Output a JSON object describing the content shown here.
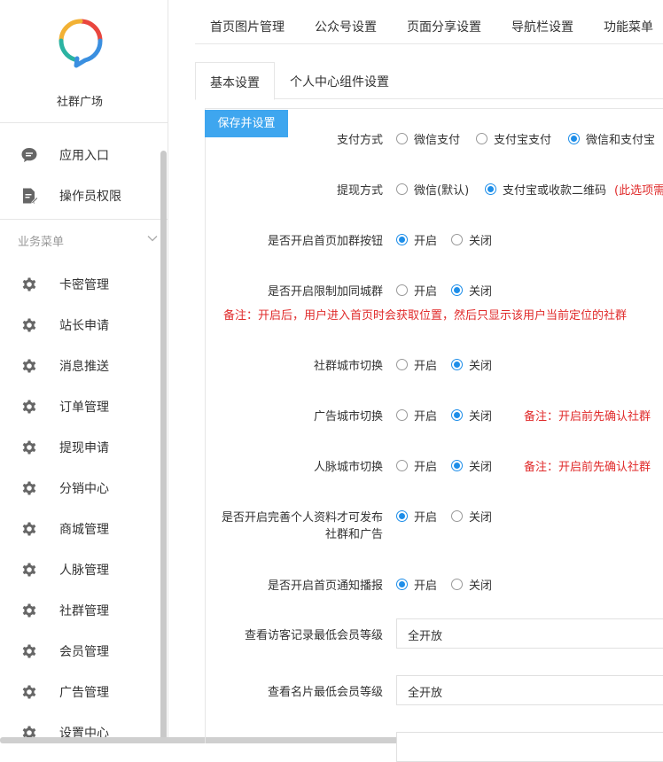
{
  "sidebar": {
    "brand": "社群广场",
    "items_top": [
      {
        "label": "应用入口",
        "icon": "chat-bubble-icon"
      },
      {
        "label": "操作员权限",
        "icon": "document-edit-icon"
      }
    ],
    "group_title": "业务菜单",
    "items": [
      {
        "label": "卡密管理",
        "icon": "gear-icon"
      },
      {
        "label": "站长申请",
        "icon": "gear-icon"
      },
      {
        "label": "消息推送",
        "icon": "gear-icon"
      },
      {
        "label": "订单管理",
        "icon": "gear-icon"
      },
      {
        "label": "提现申请",
        "icon": "gear-icon"
      },
      {
        "label": "分销中心",
        "icon": "gear-icon"
      },
      {
        "label": "商城管理",
        "icon": "gear-icon"
      },
      {
        "label": "人脉管理",
        "icon": "gear-icon"
      },
      {
        "label": "社群管理",
        "icon": "gear-icon"
      },
      {
        "label": "会员管理",
        "icon": "gear-icon"
      },
      {
        "label": "广告管理",
        "icon": "gear-icon"
      },
      {
        "label": "设置中心",
        "icon": "gear-icon"
      }
    ]
  },
  "topnav": [
    "首页图片管理",
    "公众号设置",
    "页面分享设置",
    "导航栏设置",
    "功能菜单"
  ],
  "subtabs": [
    "基本设置",
    "个人中心组件设置"
  ],
  "save_label": "保存并设置",
  "settings": {
    "pay": {
      "label": "支付方式",
      "options": [
        "微信支付",
        "支付宝支付",
        "微信和支付宝"
      ],
      "selected": 2
    },
    "withdraw": {
      "label": "提现方式",
      "options": [
        "微信(默认)",
        "支付宝或收款二维码"
      ],
      "selected": 1,
      "tail": "(此选项需"
    },
    "home_join": {
      "label": "是否开启首页加群按钮",
      "options": [
        "开启",
        "关闭"
      ],
      "selected": 0
    },
    "city_limit": {
      "label": "是否开启限制加同城群",
      "options": [
        "开启",
        "关闭"
      ],
      "selected": 1,
      "note": "备注：开启后，用户进入首页时会获取位置，然后只显示该用户当前定位的社群"
    },
    "group_city": {
      "label": "社群城市切换",
      "options": [
        "开启",
        "关闭"
      ],
      "selected": 1
    },
    "ad_city": {
      "label": "广告城市切换",
      "options": [
        "开启",
        "关闭"
      ],
      "selected": 1,
      "note": "备注：开启前先确认社群"
    },
    "contact_city": {
      "label": "人脉城市切换",
      "options": [
        "开启",
        "关闭"
      ],
      "selected": 1,
      "note": "备注：开启前先确认社群"
    },
    "profile_required": {
      "label_line1": "是否开启完善个人资料才可发布",
      "label_line2": "社群和广告",
      "options": [
        "开启",
        "关闭"
      ],
      "selected": 0
    },
    "home_notice": {
      "label": "是否开启首页通知播报",
      "options": [
        "开启",
        "关闭"
      ],
      "selected": 0
    },
    "visitor_level": {
      "label": "查看访客记录最低会员等级",
      "value": "全开放"
    },
    "card_level": {
      "label": "查看名片最低会员等级",
      "value": "全开放"
    }
  },
  "colors": {
    "accent": "#3ea6ef",
    "radio_on": "#1e8ee9",
    "note": "#e02b2b"
  }
}
